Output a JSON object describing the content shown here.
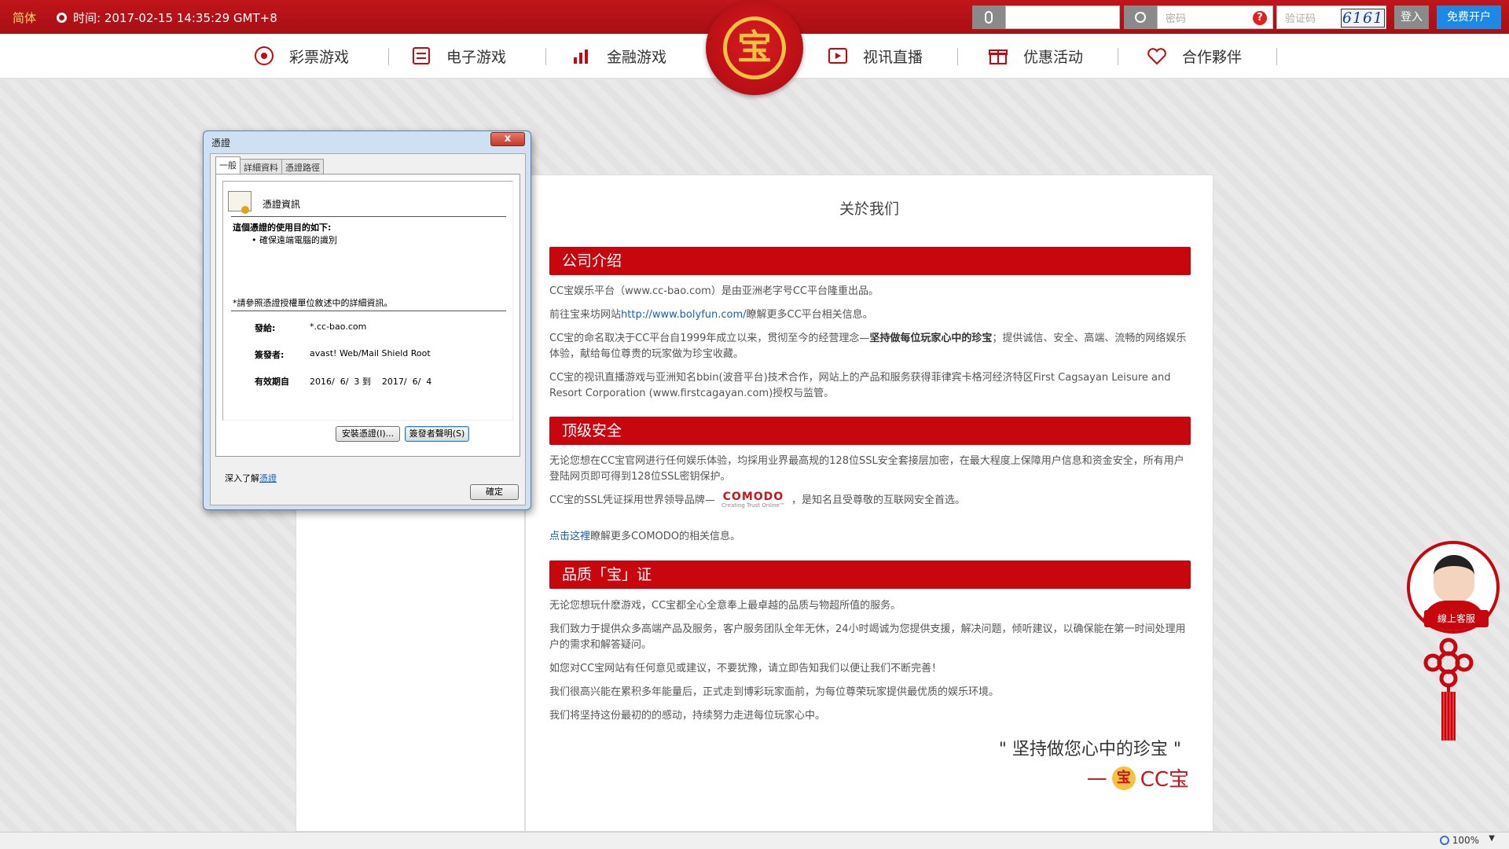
{
  "topbar": {
    "lang": "简体",
    "time": "时间: 2017-02-15 14:35:29 GMT+8",
    "password_placeholder": "密码",
    "captcha_placeholder": "验证码",
    "captcha_code": "6161",
    "login_label": "登入",
    "register_label": "免费开户"
  },
  "nav": {
    "items": [
      {
        "label": "彩票游戏"
      },
      {
        "label": "电子游戏"
      },
      {
        "label": "金融游戏"
      },
      {
        "label": "视讯直播"
      },
      {
        "label": "优惠活动"
      },
      {
        "label": "合作夥伴"
      }
    ],
    "logo_char": "宝"
  },
  "content": {
    "title": "关於我们",
    "sections": [
      {
        "heading": "公司介绍"
      },
      {
        "heading": "顶级安全"
      },
      {
        "heading": "品质「宝」证"
      }
    ],
    "p1": "CC宝娱乐平台（www.cc-bao.com）是由亚洲老字号CC平台隆重出品。",
    "p2_pre": "前往宝来坊网站",
    "p2_link": "http://www.bolyfun.com/",
    "p2_post": "瞭解更多CC平台相关信息。",
    "p3_pre": "CC宝的命名取决于CC平台自1999年成立以来，贯彻至今的经营理念—",
    "p3_bold": "坚持做每位玩家心中的珍宝",
    "p3_post": "；提供诚信、安全、高端、流畅的网络娱乐体验，献给每位尊贵的玩家做为珍宝收藏。",
    "p4": "CC宝的视讯直播游戏与亚洲知名bbin(波音平台)技术合作，网站上的产品和服务获得菲律宾卡格河经济特区First Cagsayan Leisure and Resort Corporation (www.firstcagayan.com)授权与监管。",
    "p5": "无论您想在CC宝官网进行任何娱乐体验，均採用业界最高规的128位SSL安全套接层加密，在最大程度上保障用户信息和资金安全，所有用户登陆网页即可得到128位SSL密钥保护。",
    "p6_pre": "CC宝的SSL凭证採用世界领导品牌—",
    "comodo_name": "COMODO",
    "comodo_tagline": "Creating Trust Online™",
    "p6_post": "，是知名且受尊敬的互联网安全首选。",
    "p7_link": "点击这裡",
    "p7_post": "瞭解更多COMODO的相关信息。",
    "p8": "无论您想玩什麽游戏，CC宝都全心全意奉上最卓越的品质与物超所值的服务。",
    "p9": "我们致力于提供众多高端产品及服务，客户服务团队全年无休，24小时竭诚为您提供支援，解决问题，倾听建议，以确保能在第一时间处理用户的需求和解答疑问。",
    "p10": "如您对CC宝网站有任何意见或建议，不要犹豫，请立即告知我们以便让我们不断完善！",
    "p11": "我们很高兴能在累积多年能量后，正式走到博彩玩家面前，为每位尊荣玩家提供最优质的娱乐环境。",
    "p12": "我们将坚持这份最初的的感动，持续努力走进每位玩家心中。",
    "slogan": "\" 坚持做您心中的珍宝 \"",
    "sign_dash": "—",
    "sign_coin": "宝",
    "sign_text": "CC宝"
  },
  "cs": {
    "label": "線上客服"
  },
  "status": {
    "zoom": "100%"
  },
  "dialog": {
    "title": "憑證",
    "close": "x",
    "tabs": [
      "一般",
      "詳細資料",
      "憑證路徑"
    ],
    "cert_header": "憑證資訊",
    "purpose_title": "這個憑證的使用目的如下:",
    "purpose_item": "• 確保遠端電腦的識別",
    "note": "*請參照憑證授權單位敘述中的詳細資訊。",
    "issued_to_key": "發給:",
    "issued_to_val": "*.cc-bao.com",
    "issuer_key": "簽發者:",
    "issuer_val": "avast! Web/Mail Shield Root",
    "valid_key": "有效期自",
    "valid_val": "2016/  6/  3 到    2017/  6/  4",
    "install_btn": "安裝憑證(I)...",
    "issuer_stmt_btn": "簽發者聲明(S)",
    "learn_pre": "深入了解",
    "learn_link": "憑證",
    "ok_btn": "確定"
  }
}
